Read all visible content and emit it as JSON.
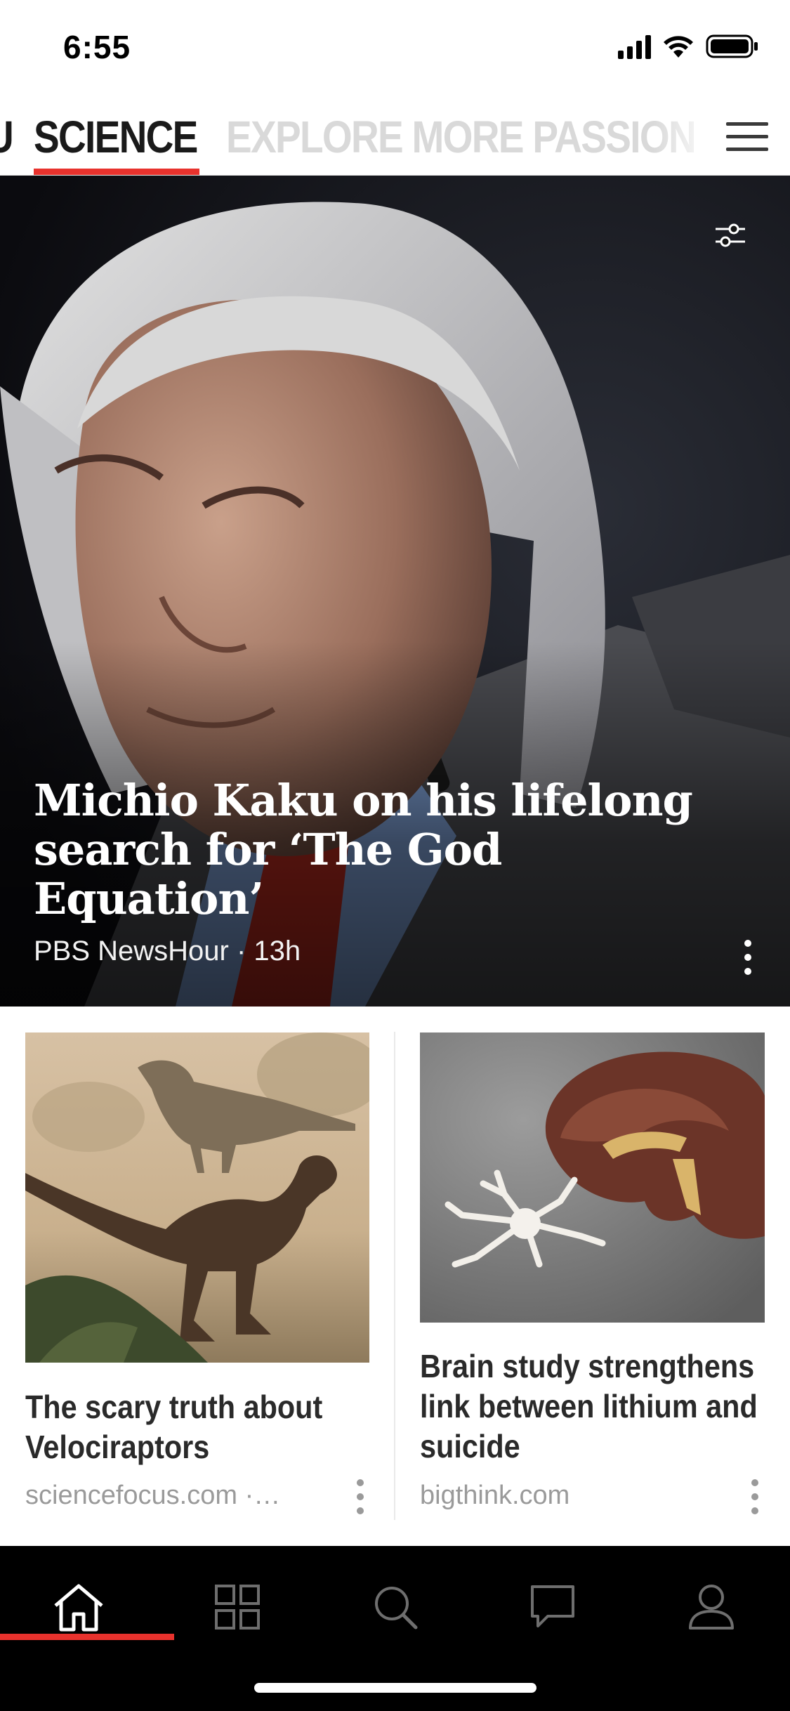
{
  "status_bar": {
    "time": "6:55",
    "signal_icon": "cellular-signal-icon",
    "wifi_icon": "wifi-icon",
    "battery_icon": "battery-icon"
  },
  "top_nav": {
    "tabs": [
      {
        "label": "U",
        "state": "partial"
      },
      {
        "label": "SCIENCE",
        "state": "selected"
      },
      {
        "label": "EXPLORE MORE PASSION",
        "state": "inactive"
      }
    ],
    "accent_color": "#e8322d",
    "menu_icon": "hamburger-menu-icon"
  },
  "hero": {
    "title": "Michio Kaku on his lifelong search for ‘The God Equation’",
    "meta": "PBS NewsHour · 13h",
    "filter_icon": "sliders-icon",
    "more_icon": "vertical-dots-icon"
  },
  "cards": [
    {
      "title": "The scary truth about Velociraptors",
      "source": "sciencefocus.com ·…",
      "more_icon": "vertical-dots-icon"
    },
    {
      "title": "Brain study strengthens link between lithium and suicide",
      "source": "bigthink.com",
      "more_icon": "vertical-dots-icon"
    }
  ],
  "bottom_nav": {
    "items": [
      {
        "icon": "home-icon",
        "state": "selected"
      },
      {
        "icon": "grid-icon",
        "state": "inactive"
      },
      {
        "icon": "search-icon",
        "state": "inactive"
      },
      {
        "icon": "chat-bubble-icon",
        "state": "inactive"
      },
      {
        "icon": "profile-icon",
        "state": "inactive"
      }
    ]
  }
}
